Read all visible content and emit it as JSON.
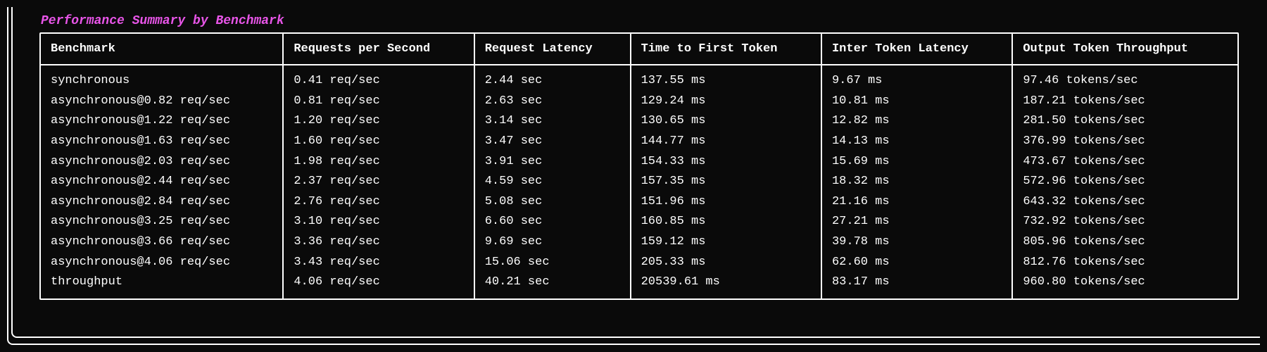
{
  "title": "Performance Summary by Benchmark",
  "headers": {
    "benchmark": "Benchmark",
    "rps": "Requests per Second",
    "latency": "Request Latency",
    "ttft": "Time to First Token",
    "itl": "Inter Token Latency",
    "throughput": "Output Token Throughput"
  },
  "rows": [
    {
      "benchmark": "synchronous",
      "rps": "0.41 req/sec",
      "latency": "2.44 sec",
      "ttft": "137.55 ms",
      "itl": "9.67 ms",
      "throughput": "97.46 tokens/sec"
    },
    {
      "benchmark": "asynchronous@0.82 req/sec",
      "rps": "0.81 req/sec",
      "latency": "2.63 sec",
      "ttft": "129.24 ms",
      "itl": "10.81 ms",
      "throughput": "187.21 tokens/sec"
    },
    {
      "benchmark": "asynchronous@1.22 req/sec",
      "rps": "1.20 req/sec",
      "latency": "3.14 sec",
      "ttft": "130.65 ms",
      "itl": "12.82 ms",
      "throughput": "281.50 tokens/sec"
    },
    {
      "benchmark": "asynchronous@1.63 req/sec",
      "rps": "1.60 req/sec",
      "latency": "3.47 sec",
      "ttft": "144.77 ms",
      "itl": "14.13 ms",
      "throughput": "376.99 tokens/sec"
    },
    {
      "benchmark": "asynchronous@2.03 req/sec",
      "rps": "1.98 req/sec",
      "latency": "3.91 sec",
      "ttft": "154.33 ms",
      "itl": "15.69 ms",
      "throughput": "473.67 tokens/sec"
    },
    {
      "benchmark": "asynchronous@2.44 req/sec",
      "rps": "2.37 req/sec",
      "latency": "4.59 sec",
      "ttft": "157.35 ms",
      "itl": "18.32 ms",
      "throughput": "572.96 tokens/sec"
    },
    {
      "benchmark": "asynchronous@2.84 req/sec",
      "rps": "2.76 req/sec",
      "latency": "5.08 sec",
      "ttft": "151.96 ms",
      "itl": "21.16 ms",
      "throughput": "643.32 tokens/sec"
    },
    {
      "benchmark": "asynchronous@3.25 req/sec",
      "rps": "3.10 req/sec",
      "latency": "6.60 sec",
      "ttft": "160.85 ms",
      "itl": "27.21 ms",
      "throughput": "732.92 tokens/sec"
    },
    {
      "benchmark": "asynchronous@3.66 req/sec",
      "rps": "3.36 req/sec",
      "latency": "9.69 sec",
      "ttft": "159.12 ms",
      "itl": "39.78 ms",
      "throughput": "805.96 tokens/sec"
    },
    {
      "benchmark": "asynchronous@4.06 req/sec",
      "rps": "3.43 req/sec",
      "latency": "15.06 sec",
      "ttft": "205.33 ms",
      "itl": "62.60 ms",
      "throughput": "812.76 tokens/sec"
    },
    {
      "benchmark": "throughput",
      "rps": "4.06 req/sec",
      "latency": "40.21 sec",
      "ttft": "20539.61 ms",
      "itl": "83.17 ms",
      "throughput": "960.80 tokens/sec"
    }
  ]
}
